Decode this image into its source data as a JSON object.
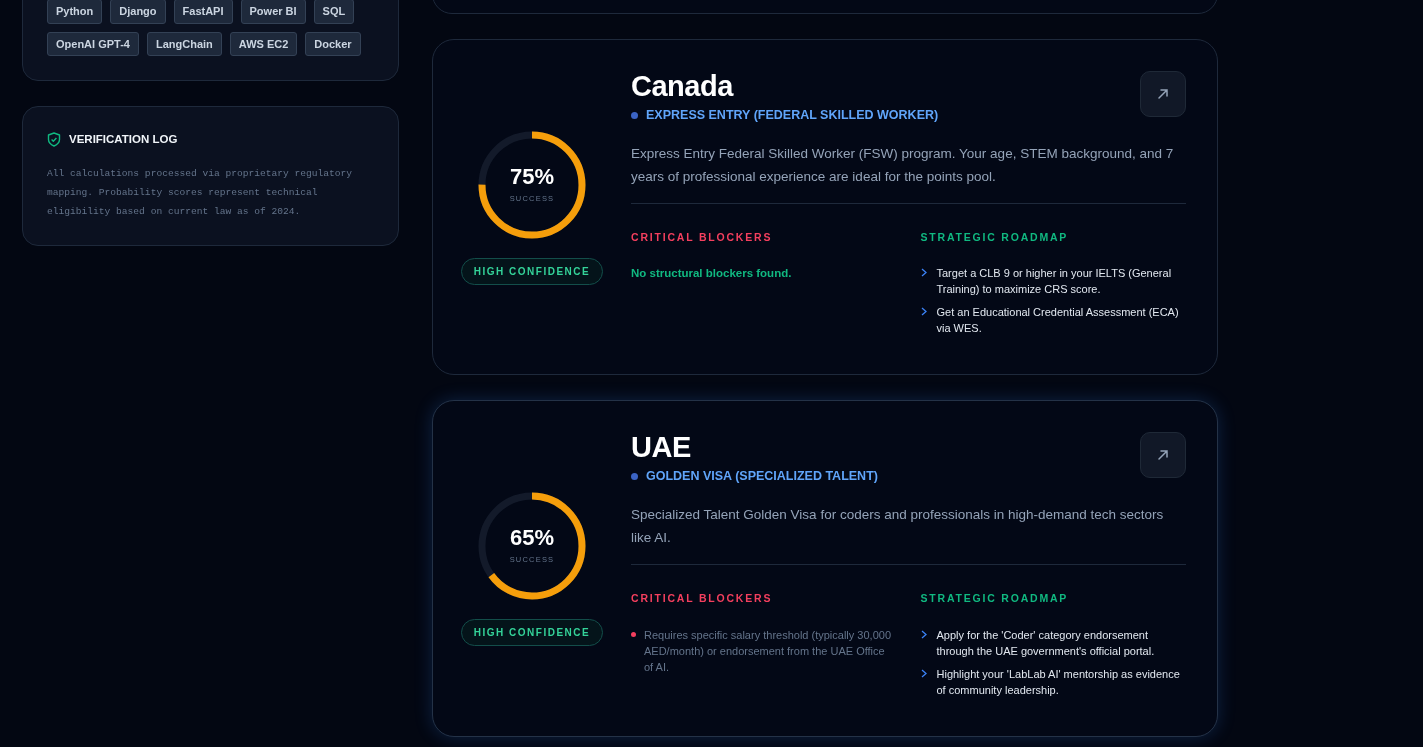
{
  "skills": {
    "tags": [
      "Python",
      "Django",
      "FastAPI",
      "Power BI",
      "SQL",
      "OpenAI GPT-4",
      "LangChain",
      "AWS EC2",
      "Docker"
    ]
  },
  "verification_log": {
    "title": "VERIFICATION LOG",
    "text": "All calculations processed via proprietary regulatory mapping. Probability scores represent technical eligibility based on current law as of 2024."
  },
  "results": [
    {
      "country": "Canada",
      "program": "EXPRESS ENTRY (FEDERAL SKILLED WORKER)",
      "description": "Express Entry Federal Skilled Worker (FSW) program. Your age, STEM background, and 7 years of professional experience are ideal for the points pool.",
      "score": "75%",
      "score_label": "SUCCESS",
      "level": 0.75,
      "confidence": "HIGH CONFIDENCE",
      "highlighted": false,
      "blockers_title": "CRITICAL BLOCKERS",
      "blockers": [
        {
          "kind": "clear",
          "text": "No structural blockers found."
        }
      ],
      "roadmap_title": "STRATEGIC ROADMAP",
      "roadmap": [
        "Target a CLB 9 or higher in your IELTS (General Training) to maximize CRS score.",
        "Get an Educational Credential Assessment (ECA) via WES."
      ]
    },
    {
      "country": "UAE",
      "program": "GOLDEN VISA (SPECIALIZED TALENT)",
      "description": "Specialized Talent Golden Visa for coders and professionals in high-demand tech sectors like AI.",
      "score": "65%",
      "score_label": "SUCCESS",
      "level": 0.65,
      "confidence": "HIGH CONFIDENCE",
      "highlighted": true,
      "blockers_title": "CRITICAL BLOCKERS",
      "blockers": [
        {
          "kind": "issue",
          "text": "Requires specific salary threshold (typically 30,000 AED/month) or endorsement from the UAE Office of AI."
        }
      ],
      "roadmap_title": "STRATEGIC ROADMAP",
      "roadmap": [
        "Apply for the 'Coder' category endorsement through the UAE government's official portal.",
        "Highlight your 'LabLab AI' mentorship as evidence of community leadership."
      ]
    }
  ]
}
